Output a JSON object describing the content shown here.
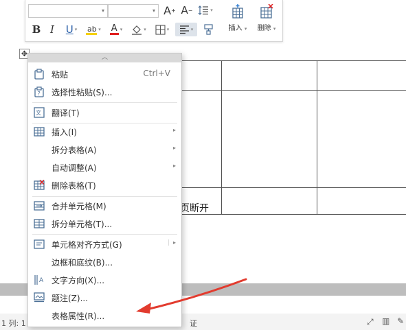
{
  "toolbar": {
    "font_grow": "A",
    "font_shrink": "A",
    "bold": "B",
    "italic": "I",
    "underline": "U",
    "font_color": "A",
    "insert_label": "插入",
    "delete_label": "删除"
  },
  "document": {
    "cell_text": "分页断开"
  },
  "context_menu": {
    "items": [
      {
        "label": "粘贴",
        "shortcut": "Ctrl+V"
      },
      {
        "label": "选择性粘贴(S)..."
      },
      {
        "label": "翻译(T)"
      },
      {
        "label": "插入(I)"
      },
      {
        "label": "拆分表格(A)"
      },
      {
        "label": "自动调整(A)"
      },
      {
        "label": "删除表格(T)"
      },
      {
        "label": "合并单元格(M)"
      },
      {
        "label": "拆分单元格(T)..."
      },
      {
        "label": "单元格对齐方式(G)"
      },
      {
        "label": "边框和底纹(B)..."
      },
      {
        "label": "文字方向(X)..."
      },
      {
        "label": "题注(Z)..."
      },
      {
        "label": "表格属性(R)..."
      }
    ]
  },
  "status_bar": {
    "left_text": "1  列: 1",
    "mid_text": "证"
  },
  "colors": {
    "annotation_arrow": "#e23b2e",
    "highlight_yellow": "#f5d000",
    "font_color_red": "#e02020",
    "table_line": "#555555"
  }
}
